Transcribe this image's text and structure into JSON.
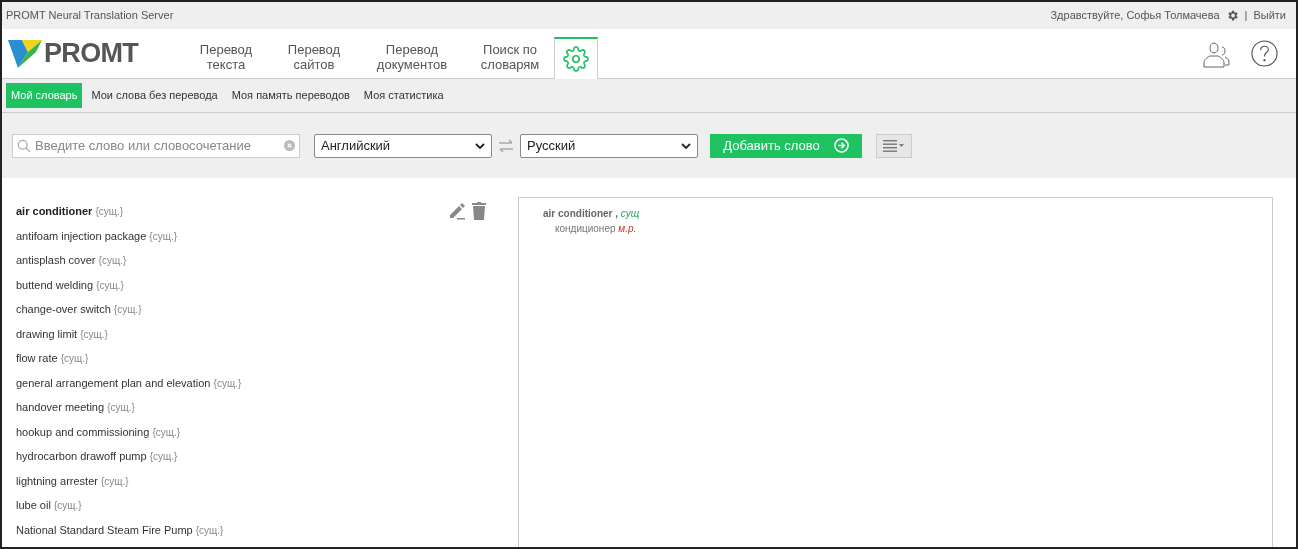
{
  "app_title": "PROMT Neural Translation Server",
  "user": {
    "greeting": "Здравствуйте, Софья Толмачева",
    "separator": "|",
    "logout": "Выйти"
  },
  "logo": {
    "text": "PROMT"
  },
  "tabs": [
    {
      "kind": "text",
      "label": "Перевод текста",
      "selected": false
    },
    {
      "kind": "text",
      "label": "Перевод сайтов",
      "selected": false
    },
    {
      "kind": "text",
      "label": "Перевод документов",
      "selected": false
    },
    {
      "kind": "text",
      "label": "Поиск по словарям",
      "selected": false
    },
    {
      "kind": "gear",
      "selected": true
    }
  ],
  "subnav": [
    {
      "label": "Мой словарь",
      "selected": true
    },
    {
      "label": "Мои слова без перевода",
      "selected": false
    },
    {
      "label": "Моя память переводов",
      "selected": false
    },
    {
      "label": "Моя статистика",
      "selected": false
    }
  ],
  "search": {
    "placeholder": "Введите слово или словосочетание"
  },
  "source_language": "Английский",
  "target_language": "Русский",
  "add_button": "Добавить слово",
  "entries": [
    {
      "term": "air conditioner",
      "pos": "{сущ.}",
      "selected": true
    },
    {
      "term": "antifoam injection package",
      "pos": "{сущ.}",
      "selected": false
    },
    {
      "term": "antisplash cover",
      "pos": "{сущ.}",
      "selected": false
    },
    {
      "term": "buttend welding",
      "pos": "{сущ.}",
      "selected": false
    },
    {
      "term": "change-over switch",
      "pos": "{сущ.}",
      "selected": false
    },
    {
      "term": "drawing limit",
      "pos": "{сущ.}",
      "selected": false
    },
    {
      "term": "flow rate",
      "pos": "{сущ.}",
      "selected": false
    },
    {
      "term": "general arrangement plan and elevation",
      "pos": "{сущ.}",
      "selected": false
    },
    {
      "term": "handover meeting",
      "pos": "{сущ.}",
      "selected": false
    },
    {
      "term": "hookup and commissioning",
      "pos": "{сущ.}",
      "selected": false
    },
    {
      "term": "hydrocarbon drawoff pump",
      "pos": "{сущ.}",
      "selected": false
    },
    {
      "term": "lightning arrester",
      "pos": "{сущ.}",
      "selected": false
    },
    {
      "term": "lube oil",
      "pos": "{сущ.}",
      "selected": false
    },
    {
      "term": "National Standard Steam Fire Pump",
      "pos": "{сущ.}",
      "selected": false
    }
  ],
  "article": {
    "headword": "air conditioner",
    "comma": ",",
    "pos": "сущ",
    "translation": "кондиционер",
    "gender": "м.р."
  }
}
